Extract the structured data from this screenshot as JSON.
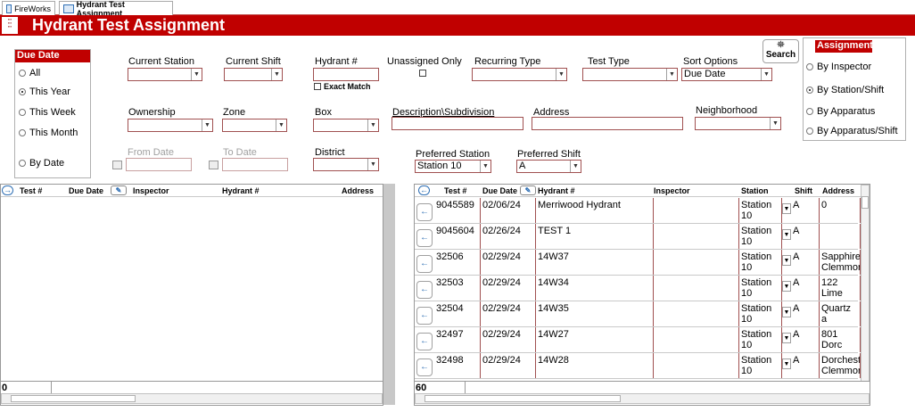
{
  "tabs": [
    {
      "label": "FireWorks"
    },
    {
      "label": "Hydrant Test Assignment"
    }
  ],
  "form_title": "Hydrant Test Assignment",
  "due_date": {
    "header": "Due Date",
    "options": [
      "All",
      "This Year",
      "This Week",
      "This Month",
      "By Date"
    ],
    "selected": "This Year"
  },
  "filters": {
    "current_station": {
      "label": "Current Station",
      "value": ""
    },
    "current_shift": {
      "label": "Current Shift",
      "value": ""
    },
    "hydrant_no": {
      "label": "Hydrant #",
      "value": ""
    },
    "exact_match": {
      "label": "Exact Match",
      "checked": false
    },
    "unassigned_only": {
      "label": "Unassigned Only",
      "checked": false
    },
    "recurring_type": {
      "label": "Recurring Type",
      "value": ""
    },
    "test_type": {
      "label": "Test Type",
      "value": ""
    },
    "sort_options": {
      "label": "Sort Options",
      "value": "Due Date"
    },
    "ownership": {
      "label": "Ownership",
      "value": ""
    },
    "zone": {
      "label": "Zone",
      "value": ""
    },
    "box": {
      "label": "Box",
      "value": ""
    },
    "description": {
      "label": "Description\\Subdivision",
      "value": ""
    },
    "address": {
      "label": "Address",
      "value": ""
    },
    "neighborhood": {
      "label": "Neighborhood",
      "value": ""
    },
    "from_date": {
      "label": "From Date",
      "value": ""
    },
    "to_date": {
      "label": "To Date",
      "value": ""
    },
    "district": {
      "label": "District",
      "value": ""
    },
    "preferred_station": {
      "label": "Preferred Station",
      "value": "Station 10"
    },
    "preferred_shift": {
      "label": "Preferred Shift",
      "value": "A"
    }
  },
  "search_button": {
    "label": "Search"
  },
  "assignment": {
    "header": "Assignment",
    "options": [
      "By Inspector",
      "By Station/Shift",
      "By Apparatus",
      "By Apparatus/Shift"
    ],
    "selected": "By Station/Shift"
  },
  "left_grid": {
    "columns": [
      "Test #",
      "Due Date",
      "Inspector",
      "Hydrant #",
      "Address"
    ],
    "count": "0"
  },
  "right_grid": {
    "columns": [
      "Test #",
      "Due Date",
      "Hydrant #",
      "Inspector",
      "Station",
      "Shift",
      "Address"
    ],
    "rows": [
      {
        "test": "9045589",
        "due": "02/06/24",
        "hydrant": "Merriwood Hydrant",
        "inspector": "",
        "station": "Station 10",
        "shift": "A",
        "address": "0"
      },
      {
        "test": "9045604",
        "due": "02/26/24",
        "hydrant": "TEST 1",
        "inspector": "",
        "station": "Station 10",
        "shift": "A",
        "address": ""
      },
      {
        "test": "32506",
        "due": "02/29/24",
        "hydrant": "14W37",
        "inspector": "",
        "station": "Station 10",
        "shift": "A",
        "address": "Sapphire Clemmor"
      },
      {
        "test": "32503",
        "due": "02/29/24",
        "hydrant": "14W34",
        "inspector": "",
        "station": "Station 10",
        "shift": "A",
        "address": "122 Lime"
      },
      {
        "test": "32504",
        "due": "02/29/24",
        "hydrant": "14W35",
        "inspector": "",
        "station": "Station 10",
        "shift": "A",
        "address": "Quartz a"
      },
      {
        "test": "32497",
        "due": "02/29/24",
        "hydrant": "14W27",
        "inspector": "",
        "station": "Station 10",
        "shift": "A",
        "address": "801 Dorc"
      },
      {
        "test": "32498",
        "due": "02/29/24",
        "hydrant": "14W28",
        "inspector": "",
        "station": "Station 10",
        "shift": "A",
        "address": "Dorchest Clemmor"
      }
    ],
    "count": "60"
  },
  "colors": {
    "accent": "#c00000",
    "border": "#a05050",
    "link": "#2f6fb4"
  }
}
